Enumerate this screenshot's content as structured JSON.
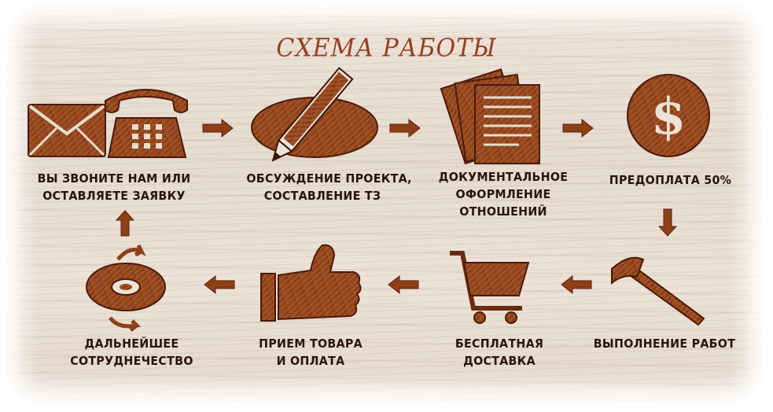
{
  "title": "СХЕМА РАБОТЫ",
  "steps": [
    {
      "line1": "ВЫ ЗВОНИТЕ НАМ ИЛИ",
      "line2": "ОСТАВЛЯЕТЕ ЗАЯВКУ",
      "icons": [
        "envelope-icon",
        "telephone-icon"
      ]
    },
    {
      "line1": "ОБСУЖДЕНИЕ ПРОЕКТА,",
      "line2": "СОСТАВЛЕНИЕ ТЗ",
      "icons": [
        "pencil-icon"
      ]
    },
    {
      "line1": "ДОКУМЕНТАЛЬНОЕ",
      "line2": "ОФОРМЛЕНИЕ",
      "line3": "ОТНОШЕНИЙ",
      "icons": [
        "documents-icon"
      ]
    },
    {
      "line1": "ПРЕДОПЛАТА 50%",
      "icons": [
        "dollar-coin-icon"
      ]
    },
    {
      "line1": "ВЫПОЛНЕНИЕ РАБОТ",
      "icons": [
        "axe-icon"
      ]
    },
    {
      "line1": "БЕСПЛАТНАЯ",
      "line2": "ДОСТАВКА",
      "icons": [
        "shopping-cart-icon"
      ]
    },
    {
      "line1": "ПРИЕМ ТОВАРА",
      "line2": "И ОПЛАТА",
      "icons": [
        "thumbs-up-icon"
      ]
    },
    {
      "line1": "ДАЛЬНЕЙШЕЕ",
      "line2": "СОТРУДНЕЧЕСТВО",
      "icons": [
        "disc-cycle-icon"
      ]
    }
  ],
  "colors": {
    "wood_dark": "#6b2a10",
    "wood_mid": "#9b4a1f",
    "wood_light": "#c0733a",
    "title": "#9a3d1d",
    "text": "#2a1408"
  }
}
